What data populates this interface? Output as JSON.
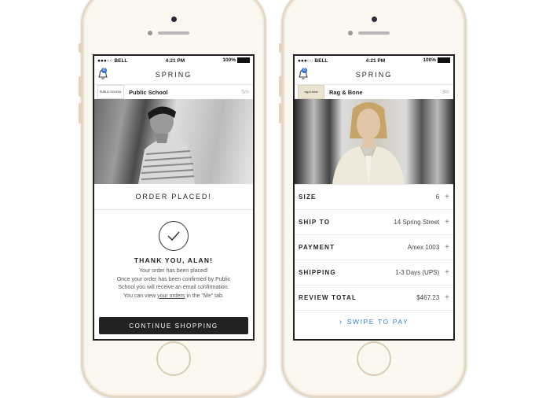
{
  "left_phone": {
    "status": {
      "carrier": "●●●○○ BELL",
      "time": "4:21 PM",
      "battery": "100%"
    },
    "nav_title": "SPRING",
    "notification_count": "8",
    "brand": {
      "name": "Public School",
      "time": "5m",
      "logo_text": "PUBLIC SCHOOL"
    },
    "order_placed": "ORDER PLACED!",
    "thanks": "THANK YOU, ALAN!",
    "msg_line1": "Your order has been placed!",
    "msg_line2": "Once your order has been confirmed by Public",
    "msg_line3": "School you will receive an email confirmation.",
    "msg_line4a": "You can view ",
    "msg_link": "your orders",
    "msg_line4b": " in the \"Me\" tab.",
    "continue_label": "CONTINUE SHOPPING"
  },
  "right_phone": {
    "status": {
      "carrier": "●●●○○ BELL",
      "time": "4:21 PM",
      "battery": "100%"
    },
    "nav_title": "SPRING",
    "notification_count": "8",
    "brand": {
      "name": "Rag & Bone",
      "time": "3m",
      "logo_text": "rag & bone"
    },
    "rows": [
      {
        "label": "SIZE",
        "value": "6"
      },
      {
        "label": "SHIP TO",
        "value": "14 Spring Street"
      },
      {
        "label": "PAYMENT",
        "value": "Amex  1003"
      },
      {
        "label": "SHIPPING",
        "value": "1-3 Days (UPS)"
      },
      {
        "label": "REVIEW TOTAL",
        "value": "$467.23"
      }
    ],
    "swipe_label": "SWIPE TO PAY"
  },
  "colors": {
    "accent": "#2f7fd4",
    "button": "#222222",
    "frame": "#e3d8c3"
  }
}
